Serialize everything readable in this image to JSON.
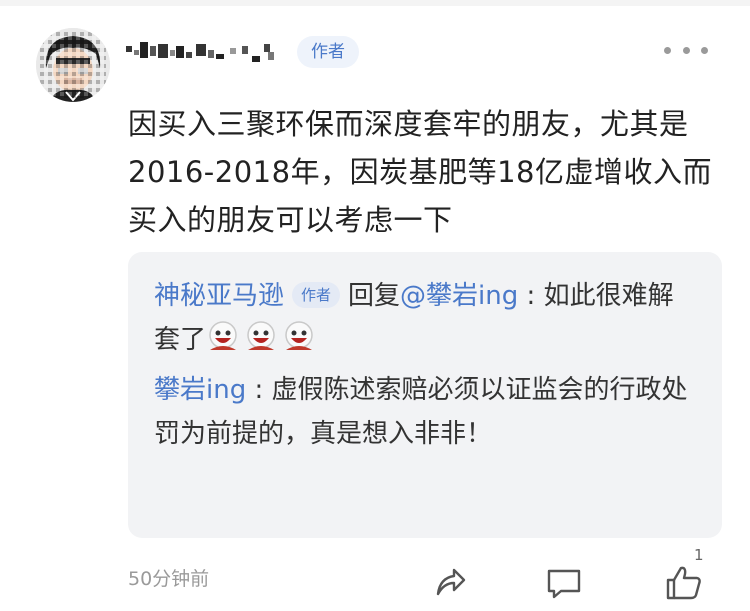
{
  "comment": {
    "author_badge": "作者",
    "body": "因买入三聚环保而深度套牢的朋友，尤其是2016-2018年，因炭基肥等18亿虚增收入而买入的朋友可以考虑一下",
    "timestamp": "50分钟前",
    "like_count": "1",
    "icons": [
      "more-icon",
      "share-icon",
      "comment-icon",
      "like-icon"
    ]
  },
  "replies": [
    {
      "author": "神秘亚马逊",
      "author_badge": "作者",
      "reply_word": "回复",
      "target": "@攀岩ing",
      "separator": " : ",
      "text": "如此很难解套了",
      "emoji_count": 3
    },
    {
      "author": "攀岩ing",
      "separator": " : ",
      "text": "虚假陈述索赔必须以证监会的行政处罚为前提的，真是想入非非！"
    }
  ],
  "colors": {
    "link_blue": "#4a79c9",
    "reply_background": "#f2f3f5",
    "muted_gray": "#9a9a9a"
  }
}
